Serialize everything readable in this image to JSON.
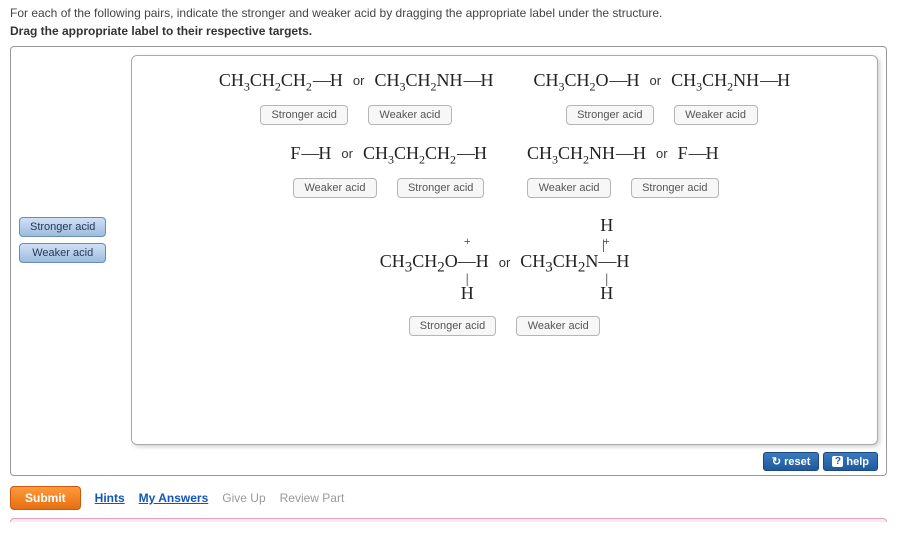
{
  "instructions_line1": "For each of the following pairs, indicate the stronger and weaker acid by dragging the appropriate label under the structure.",
  "instructions_line2": "Drag the appropriate label to their respective targets.",
  "palette": {
    "stronger": "Stronger acid",
    "weaker": "Weaker acid"
  },
  "or_label": "or",
  "rows": [
    {
      "pairs": [
        {
          "left_html": "CH<sub>3</sub>CH<sub>2</sub>CH<sub>2</sub><span class='bond'>—</span>H",
          "right_html": "CH<sub>3</sub>CH<sub>2</sub>NH<span class='bond'>—</span>H",
          "left_slot": "Stronger acid",
          "right_slot": "Weaker acid"
        },
        {
          "left_html": "CH<sub>3</sub>CH<sub>2</sub>O<span class='bond'>—</span>H",
          "right_html": "CH<sub>3</sub>CH<sub>2</sub>NH<span class='bond'>—</span>H",
          "left_slot": "Stronger acid",
          "right_slot": "Weaker acid"
        }
      ]
    },
    {
      "pairs": [
        {
          "left_html": "F<span class='bond'>—</span>H",
          "right_html": "CH<sub>3</sub>CH<sub>2</sub>CH<sub>2</sub><span class='bond'>—</span>H",
          "left_slot": "Weaker acid",
          "right_slot": "Stronger acid"
        },
        {
          "left_html": "CH<sub>3</sub>CH<sub>2</sub>NH<span class='bond'>—</span>H",
          "right_html": "F<span class='bond'>—</span>H",
          "left_slot": "Weaker acid",
          "right_slot": "Stronger acid"
        }
      ]
    },
    {
      "pairs": [
        {
          "left_complex": {
            "top": "",
            "charge": "+",
            "main": "CH<sub>3</sub>CH<sub>2</sub>O<span class='bond'>—</span>H",
            "bottom": "H"
          },
          "right_complex": {
            "top": "H",
            "charge": "+",
            "main": "CH<sub>3</sub>CH<sub>2</sub>N<span class='bond'>—</span>H",
            "bottom": "H"
          },
          "left_slot": "Stronger acid",
          "right_slot": "Weaker acid"
        }
      ]
    }
  ],
  "toolbar": {
    "reset": "reset",
    "help": "help"
  },
  "footer": {
    "submit": "Submit",
    "hints": "Hints",
    "my_answers": "My Answers",
    "give_up": "Give Up",
    "review": "Review Part"
  }
}
